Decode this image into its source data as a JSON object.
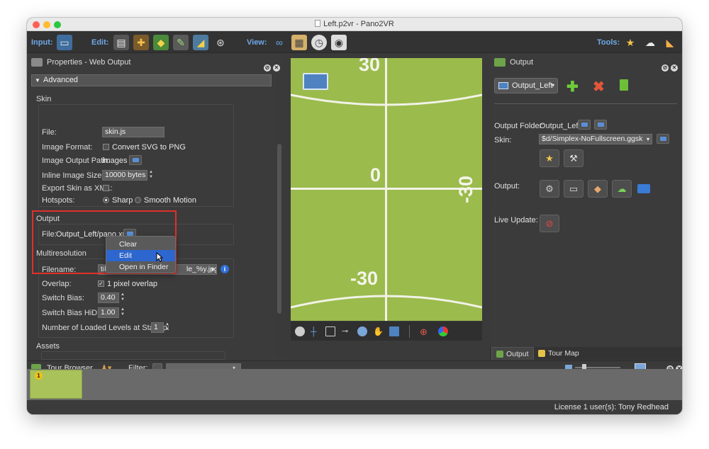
{
  "window": {
    "title": "Left.p2vr - Pano2VR"
  },
  "toolbar": {
    "input_label": "Input:",
    "edit_label": "Edit:",
    "view_label": "View:",
    "tools_label": "Tools:",
    "icons": [
      "input-panorama-icon",
      "edit-patches-icon",
      "edit-hotspots-icon",
      "edit-layers-icon",
      "edit-map-icon",
      "edit-media-icon",
      "view-binoculars-icon",
      "view-clipboard-icon",
      "view-compass-icon",
      "view-eye-icon",
      "tools-wand-icon",
      "tools-cloud-icon",
      "tools-eraser-icon"
    ]
  },
  "properties_panel": {
    "title": "Properties - Web Output",
    "advanced_label": "Advanced",
    "skin": {
      "section": "Skin",
      "file_label": "File:",
      "file_value": "skin.js",
      "image_format_label": "Image Format:",
      "convert_svg_label": "Convert SVG to PNG",
      "image_output_path_label": "Image Output Path:",
      "image_output_path_value": "images",
      "inline_image_size_label": "Inline Image Size:",
      "inline_image_size_value": "10000 bytes",
      "export_skin_label": "Export Skin as XML:",
      "hotspots_label": "Hotspots:",
      "hotspots_sharp": "Sharp",
      "hotspots_smooth": "Smooth Motion"
    },
    "output": {
      "section": "Output",
      "file_label": "File:",
      "file_value": "Output_Left/pano.xml"
    },
    "context_menu": {
      "items": [
        "Clear",
        "Edit",
        "Open in Finder"
      ],
      "selected": "Edit"
    },
    "multiresolution": {
      "section": "Multiresolution",
      "filename_label": "Filename:",
      "filename_value_left": "til",
      "filename_value_right": "le_%y.jpg",
      "overlap_label": "Overlap:",
      "overlap_value": "1 pixel overlap",
      "switch_bias_label": "Switch Bias:",
      "switch_bias_value": "0.40",
      "switch_bias_hidpi_label": "Switch Bias HiDPI:",
      "switch_bias_hidpi_value": "1.00",
      "loaded_levels_label": "Number of Loaded Levels at Startup:",
      "loaded_levels_value": "1"
    },
    "assets_section": "Assets"
  },
  "viewer": {
    "numbers": [
      "30",
      "0",
      "-30",
      "-30"
    ]
  },
  "output_panel": {
    "title": "Output",
    "output_select": "Output_Left",
    "output_folder_label": "Output Folder:",
    "output_folder_value": "Output_Left",
    "skin_label": "Skin:",
    "skin_value": "$d/Simplex-NoFullscreen.ggsk",
    "output_label": "Output:",
    "live_update_label": "Live Update:",
    "tabs": [
      "Output",
      "Tour Map"
    ]
  },
  "tour_browser": {
    "title": "Tour Browser",
    "filter_label": "Filter:",
    "thumb_badge": "1"
  },
  "status": {
    "license": "License 1 user(s): Tony Redhead"
  },
  "colors": {
    "accent_blue": "#2d66cf",
    "highlight_red": "#e0302a",
    "pano_green": "#9bbb4c"
  }
}
